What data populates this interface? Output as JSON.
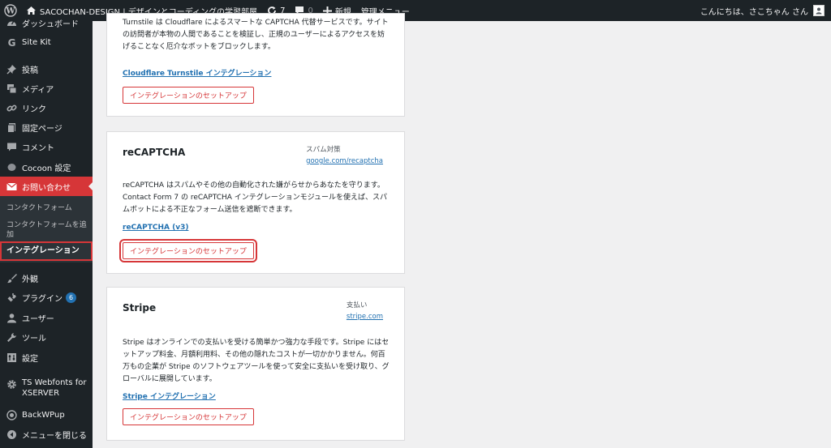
{
  "adminbar": {
    "site_name": "SACOCHAN-DESIGN | デザインとコーディングの学習部屋",
    "updates_count": "7",
    "comments_count": "0",
    "new_label": "新規",
    "admin_menu_label": "管理メニュー",
    "greeting": "こんにちは、さこちゃん さん"
  },
  "sidebar": {
    "items": [
      {
        "label": "ダッシュボード",
        "icon": "dashboard-icon"
      },
      {
        "label": "Site Kit",
        "icon": "google-g-icon"
      },
      {
        "label": "投稿",
        "icon": "pin-icon"
      },
      {
        "label": "メディア",
        "icon": "media-icon"
      },
      {
        "label": "リンク",
        "icon": "link-icon"
      },
      {
        "label": "固定ページ",
        "icon": "page-icon"
      },
      {
        "label": "コメント",
        "icon": "comment-icon"
      },
      {
        "label": "Cocoon 設定",
        "icon": "cocoon-icon"
      },
      {
        "label": "お問い合わせ",
        "icon": "mail-icon"
      },
      {
        "label": "外観",
        "icon": "brush-icon"
      },
      {
        "label": "プラグイン",
        "icon": "plugin-icon",
        "badge": "6"
      },
      {
        "label": "ユーザー",
        "icon": "user-icon"
      },
      {
        "label": "ツール",
        "icon": "wrench-icon"
      },
      {
        "label": "設定",
        "icon": "settings-icon"
      },
      {
        "label": "TS Webfonts for XSERVER",
        "icon": "gear-icon"
      },
      {
        "label": "BackWPup",
        "icon": "backwpup-icon"
      },
      {
        "label": "メニューを閉じる",
        "icon": "collapse-icon"
      }
    ],
    "submenu": [
      {
        "label": "コンタクトフォーム"
      },
      {
        "label": "コンタクトフォームを追加"
      },
      {
        "label": "インテグレーション"
      }
    ]
  },
  "cards": [
    {
      "description": "Turnstile は Cloudflare によるスマートな CAPTCHA 代替サービスです。サイトの訪問者が本物の人間であることを検証し、正規のユーザーによるアクセスを妨げることなく厄介なボットをブロックします。",
      "link_label": "Cloudflare Turnstile インテグレーション",
      "button_label": "インテグレーションのセットアップ"
    },
    {
      "title": "reCAPTCHA",
      "category": "スパム対策",
      "site": "google.com/recaptcha",
      "description": "reCAPTCHA はスパムやその他の自動化された嫌がらせからあなたを守ります。Contact Form 7 の reCAPTCHA インテグレーションモジュールを使えば、スパムボットによる不正なフォーム送信を遮断できます。",
      "link_label": "reCAPTCHA (v3)",
      "button_label": "インテグレーションのセットアップ"
    },
    {
      "title": "Stripe",
      "category": "支払い",
      "site": "stripe.com",
      "description": "Stripe はオンラインでの支払いを受ける簡単かつ強力な手段です。Stripe にはセットアップ料金、月額利用料、その他の隠れたコストが一切かかりません。何百万もの企業が Stripe のソフトウェアツールを使って安全に支払いを受け取り、グローバルに展開しています。",
      "link_label": "Stripe インテグレーション",
      "button_label": "インテグレーションのセットアップ"
    }
  ],
  "colors": {
    "admin_dark": "#1d2327",
    "accent_red": "#d63638",
    "link_blue": "#2271b1",
    "background": "#f0f0f1"
  }
}
